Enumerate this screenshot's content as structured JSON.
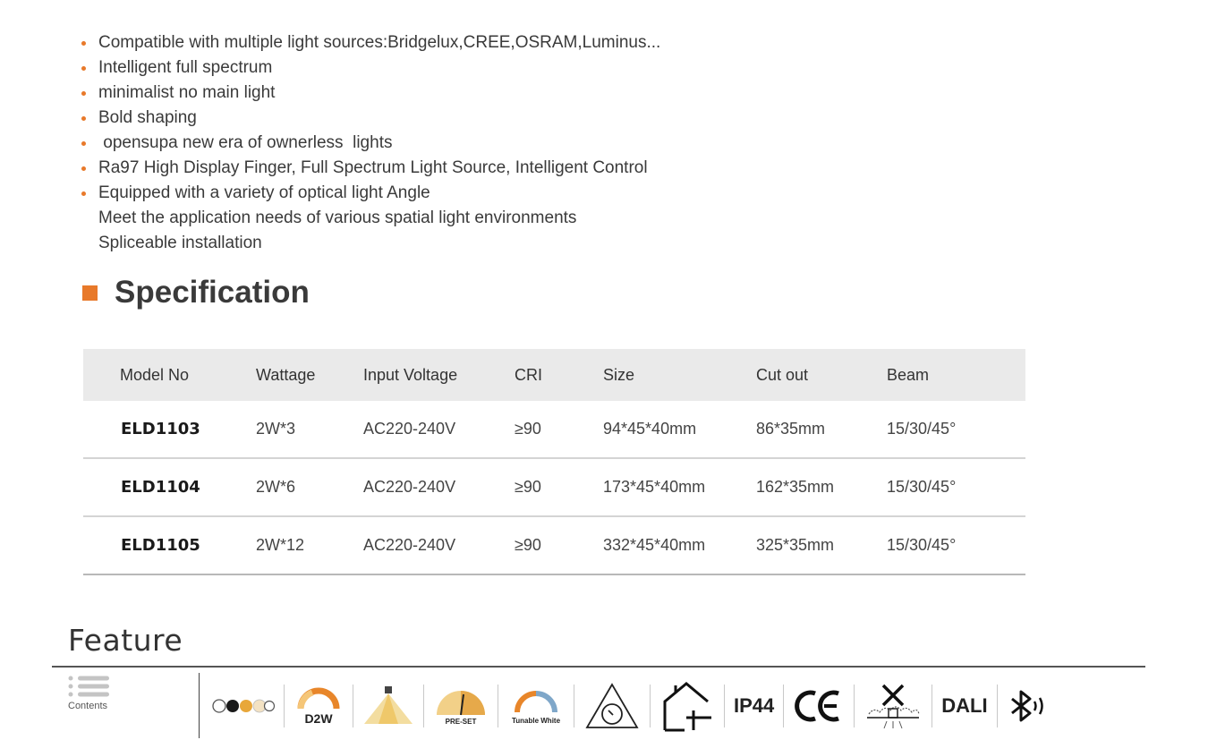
{
  "bullets": [
    "Compatible with multiple light sources:Bridgelux,CREE,OSRAM,Luminus...",
    "Intelligent full spectrum",
    "minimalist no main light",
    "Bold shaping",
    " opensupa new era of ownerless  lights",
    "Ra97 High Display Finger, Full Spectrum Light Source, Intelligent Control",
    "Equipped with a variety of optical light Angle",
    "Meet the application needs of various spatial light environments",
    "Spliceable installation"
  ],
  "specification": {
    "title": "Specification",
    "headers": [
      "Model No",
      "Wattage",
      "Input Voltage",
      "CRI",
      "Size",
      "Cut out",
      "Beam"
    ],
    "rows": [
      [
        "ELD1103",
        "2W*3",
        "AC220-240V",
        "≥90",
        "94*45*40mm",
        "86*35mm",
        "15/30/45°"
      ],
      [
        "ELD1104",
        "2W*6",
        "AC220-240V",
        "≥90",
        "173*45*40mm",
        "162*35mm",
        "15/30/45°"
      ],
      [
        "ELD1105",
        "2W*12",
        "AC220-240V",
        "≥90",
        "332*45*40mm",
        "325*35mm",
        "15/30/45°"
      ]
    ]
  },
  "feature": {
    "title": "Feature",
    "contents_label": "Contents",
    "icons": {
      "d2w": "D2W",
      "preset": "PRE-SET",
      "tunable": "Tunable White",
      "ip": "IP44",
      "ce": "CE",
      "dali": "DALI"
    }
  },
  "colors": {
    "accent": "#e8792a",
    "header_bg": "#eaeaea"
  }
}
